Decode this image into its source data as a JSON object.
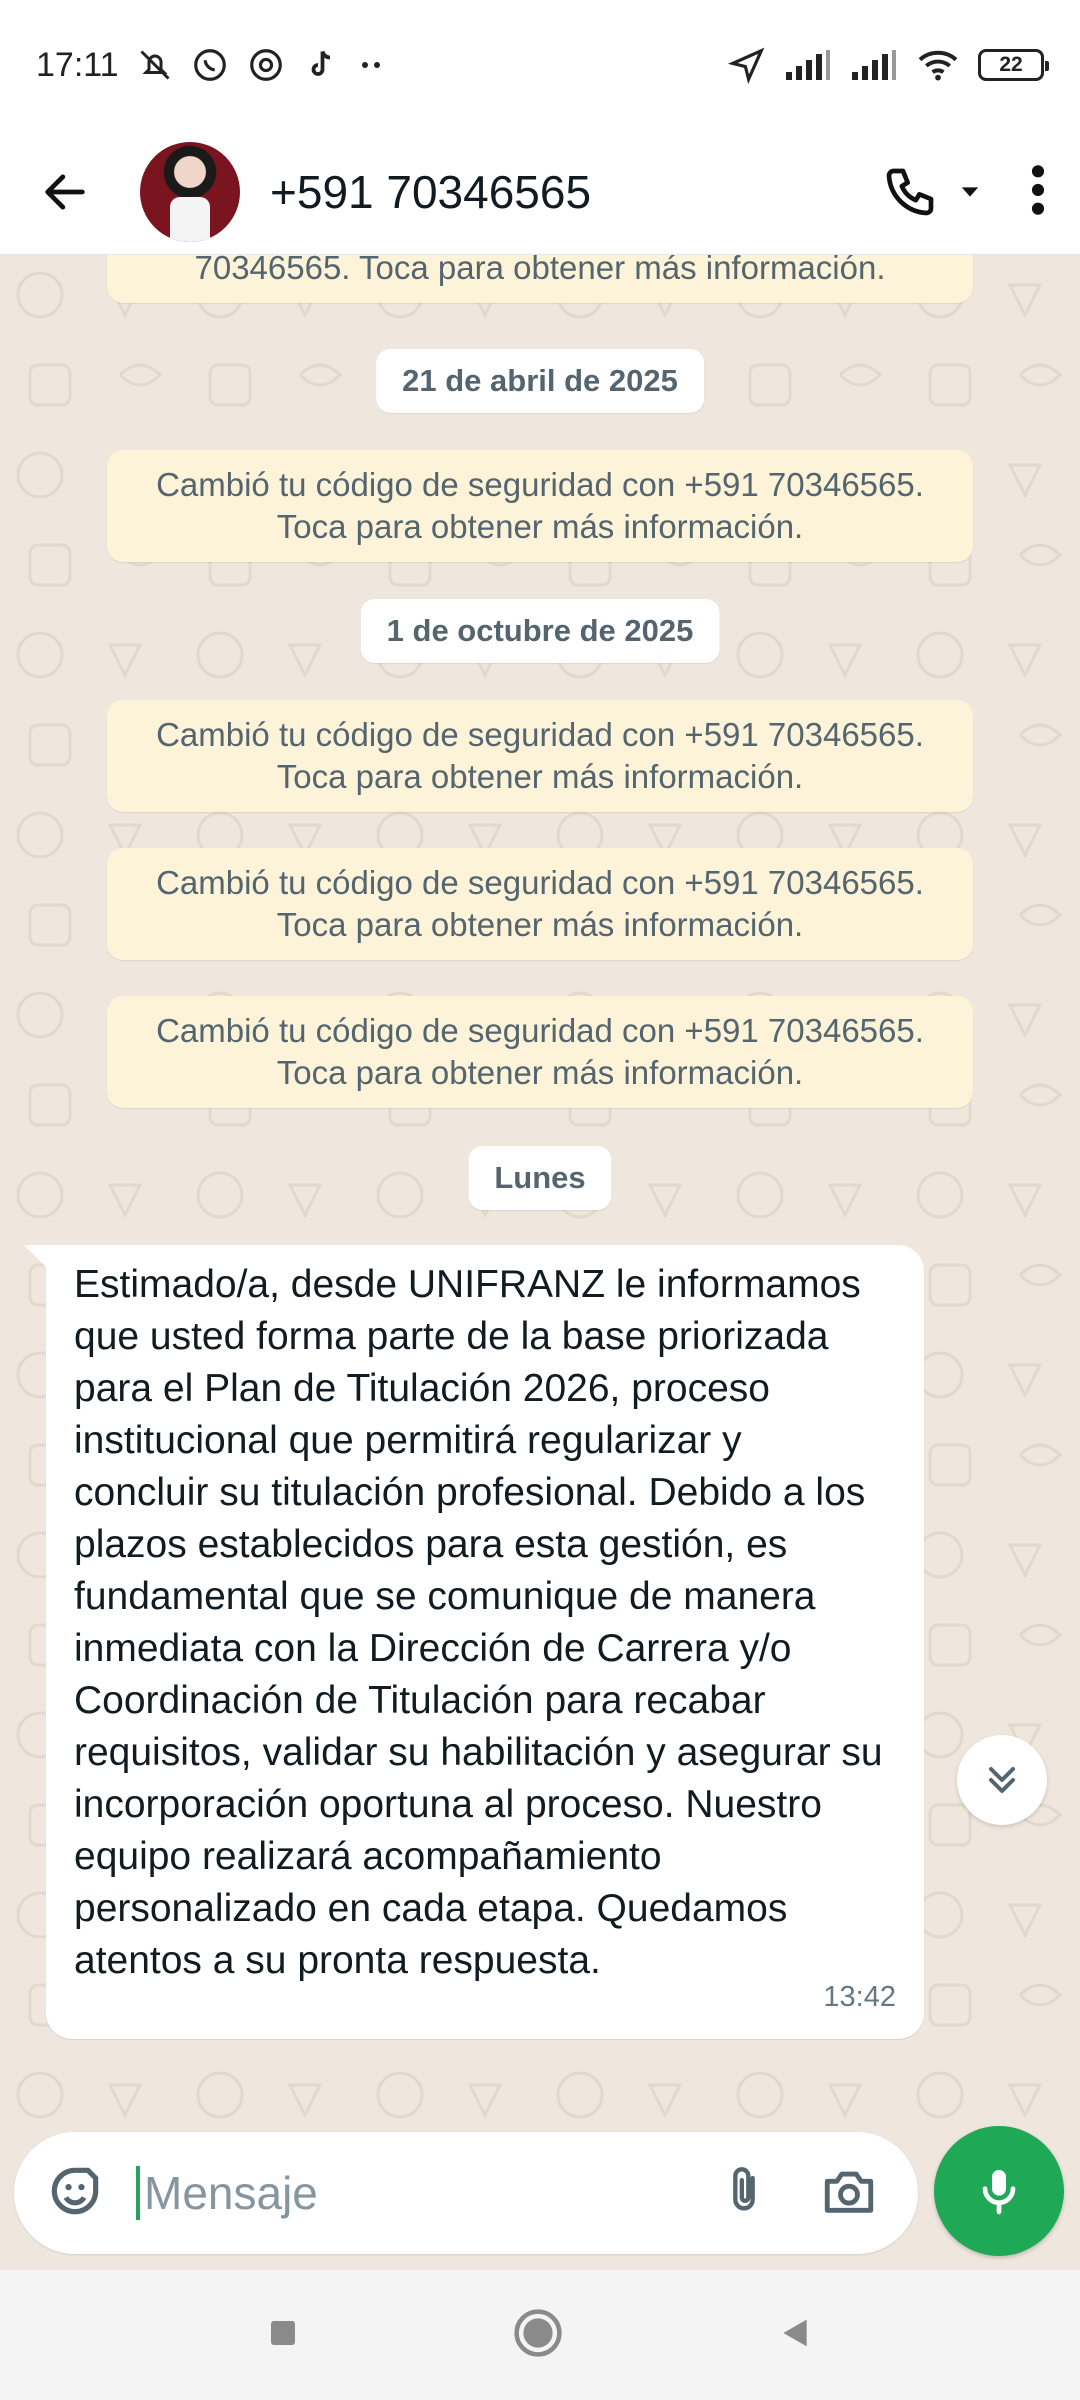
{
  "status_bar": {
    "time": "17:11",
    "notification_icons": [
      "muted-bell-icon",
      "whatsapp-icon",
      "threads-icon",
      "tiktok-icon",
      "more-dots-icon"
    ],
    "right_icons": [
      "location-arrow-icon",
      "signal-icon",
      "signal-icon",
      "wifi-icon"
    ],
    "battery": "22"
  },
  "header": {
    "contact_name": "+591 70346565",
    "actions": [
      "phone-icon",
      "dropdown-arrow-icon",
      "overflow-menu-icon"
    ]
  },
  "chat": {
    "partial_system_message": "70346565. Toca para obtener más información.",
    "date_1": "21 de abril de 2025",
    "system_message_1": "Cambió tu código de seguridad con +591 70346565. Toca para obtener más información.",
    "date_2": "1 de octubre de 2025",
    "system_message_2": "Cambió tu código de seguridad con +591 70346565. Toca para obtener más información.",
    "system_message_3": "Cambió tu código de seguridad con +591 70346565. Toca para obtener más información.",
    "system_message_4": "Cambió tu código de seguridad con +591 70346565. Toca para obtener más información.",
    "date_3": "Lunes",
    "incoming_message": {
      "text": "Estimado/a, desde UNIFRANZ le informamos que usted forma parte de la base priorizada para el Plan de Titulación 2026, proceso institucional que permitirá regularizar y concluir su titulación profesional. Debido a los plazos establecidos para esta gestión, es fundamental que se comunique de manera inmediata con la Dirección de Carrera y/o Coordinación de Titulación para recabar requisitos, validar su habilitación y asegurar su incorporación oportuna al proceso. Nuestro equipo realizará acompañamiento personalizado en cada etapa. Quedamos atentos a su pronta respuesta.",
      "time": "13:42"
    }
  },
  "composer": {
    "placeholder": "Mensaje"
  },
  "colors": {
    "accent_green": "#1fa855",
    "system_bubble": "#fdf3d8",
    "chat_background": "#efe7dd"
  }
}
